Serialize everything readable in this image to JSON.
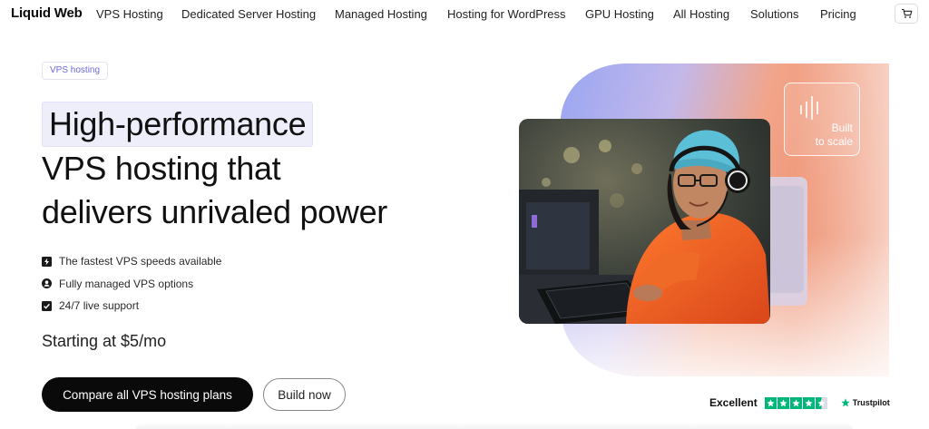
{
  "nav": {
    "logo": "Liquid Web",
    "links": [
      "VPS Hosting",
      "Dedicated Server Hosting",
      "Managed Hosting",
      "Hosting for WordPress",
      "GPU Hosting",
      "All Hosting",
      "Solutions",
      "Pricing"
    ],
    "cart_icon": "cart-icon"
  },
  "hero": {
    "badge": "VPS hosting",
    "headline_highlight": "High-performance",
    "headline_line2": "VPS hosting that",
    "headline_line3": "delivers unrivaled power",
    "features": [
      {
        "icon": "lightning-icon",
        "label": "The fastest VPS speeds available"
      },
      {
        "icon": "user-icon",
        "label": "Fully managed VPS options"
      },
      {
        "icon": "checkbox-icon",
        "label": "24/7 live support"
      }
    ],
    "price": "Starting at $5/mo",
    "primary_cta": "Compare all VPS hosting plans",
    "secondary_cta": "Build now"
  },
  "art": {
    "scale_line1": "Built",
    "scale_line2": "to scale",
    "scale_icon": "sound-bars-icon",
    "photo_icon": "gamer-photo"
  },
  "trust": {
    "label": "Excellent",
    "rating_stars": 4.5,
    "brand": "Trustpilot"
  },
  "colors": {
    "primary_button": "#0a0a0a",
    "badge_text": "#6a6ad8",
    "highlight_bg": "#eeeefb",
    "trustpilot_green": "#00b67a"
  }
}
